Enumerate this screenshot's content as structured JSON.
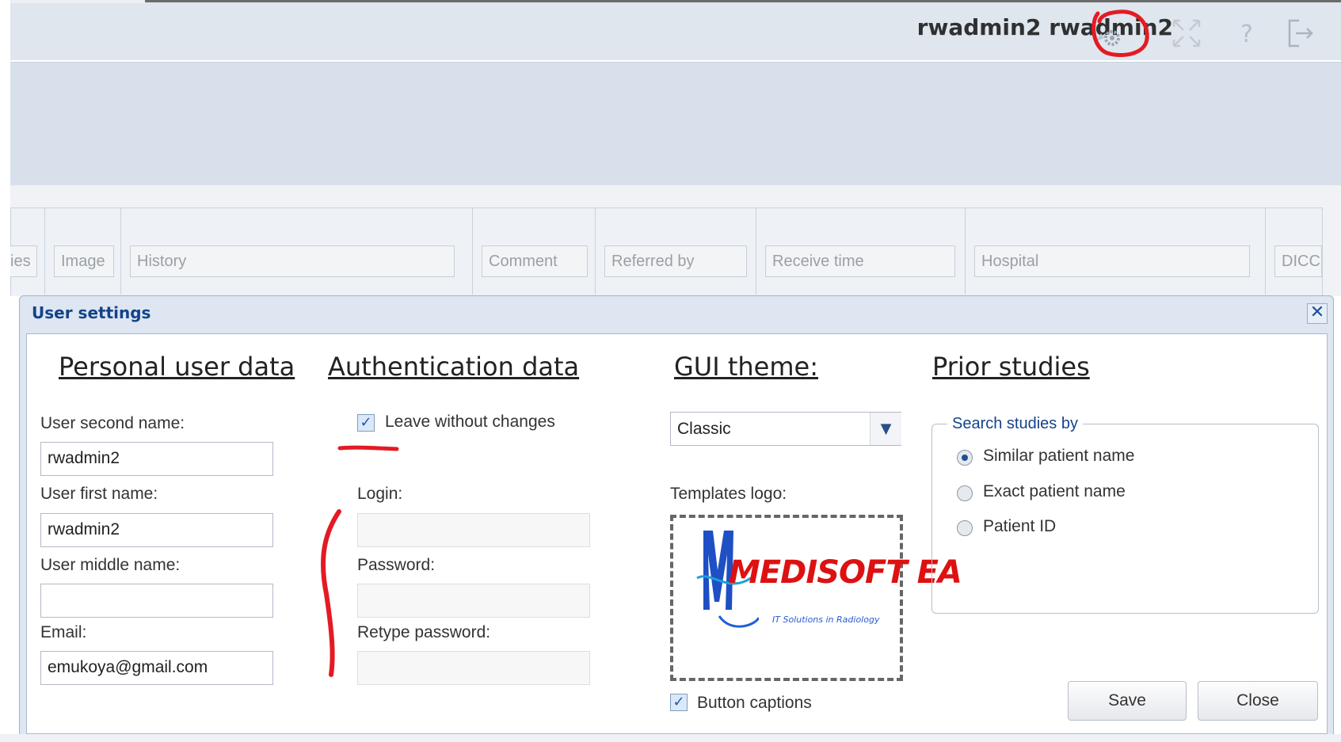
{
  "header": {
    "username": "rwadmin2 rwadmin2",
    "icons": [
      "settings-icon",
      "fullscreen-icon",
      "help-icon",
      "logout-icon"
    ]
  },
  "columns": [
    "ies",
    "Image",
    "History",
    "Comment",
    "Referred by",
    "Receive time",
    "Hospital",
    "DICC"
  ],
  "dialog": {
    "title": "User settings",
    "close_icon": "close-icon",
    "personal": {
      "title": "Personal user data",
      "second_name_label": "User second name:",
      "second_name_value": "rwadmin2",
      "first_name_label": "User first name:",
      "first_name_value": "rwadmin2",
      "middle_name_label": "User middle name:",
      "middle_name_value": "",
      "email_label": "Email:",
      "email_value": "emukoya@gmail.com"
    },
    "auth": {
      "title": "Authentication data",
      "leave_label": "Leave without changes",
      "leave_checked": true,
      "login_label": "Login:",
      "password_label": "Password:",
      "retype_label": "Retype password:"
    },
    "gui": {
      "title": "GUI theme:",
      "theme_value": "Classic",
      "logo_label": "Templates logo:",
      "logo_text": "MEDISOFT EA",
      "logo_subtext": "IT Solutions in Radiology",
      "button_captions_label": "Button captions",
      "button_captions_checked": true
    },
    "prior": {
      "title": "Prior studies",
      "search_legend": "Search studies by",
      "options": [
        "Similar patient name",
        "Exact patient name",
        "Patient ID"
      ],
      "selected": "Similar patient name"
    },
    "save_label": "Save",
    "close_label": "Close"
  },
  "colors": {
    "accent": "#15428b",
    "annotation": "#e31b23",
    "header_bg": "#dfe6ee"
  }
}
